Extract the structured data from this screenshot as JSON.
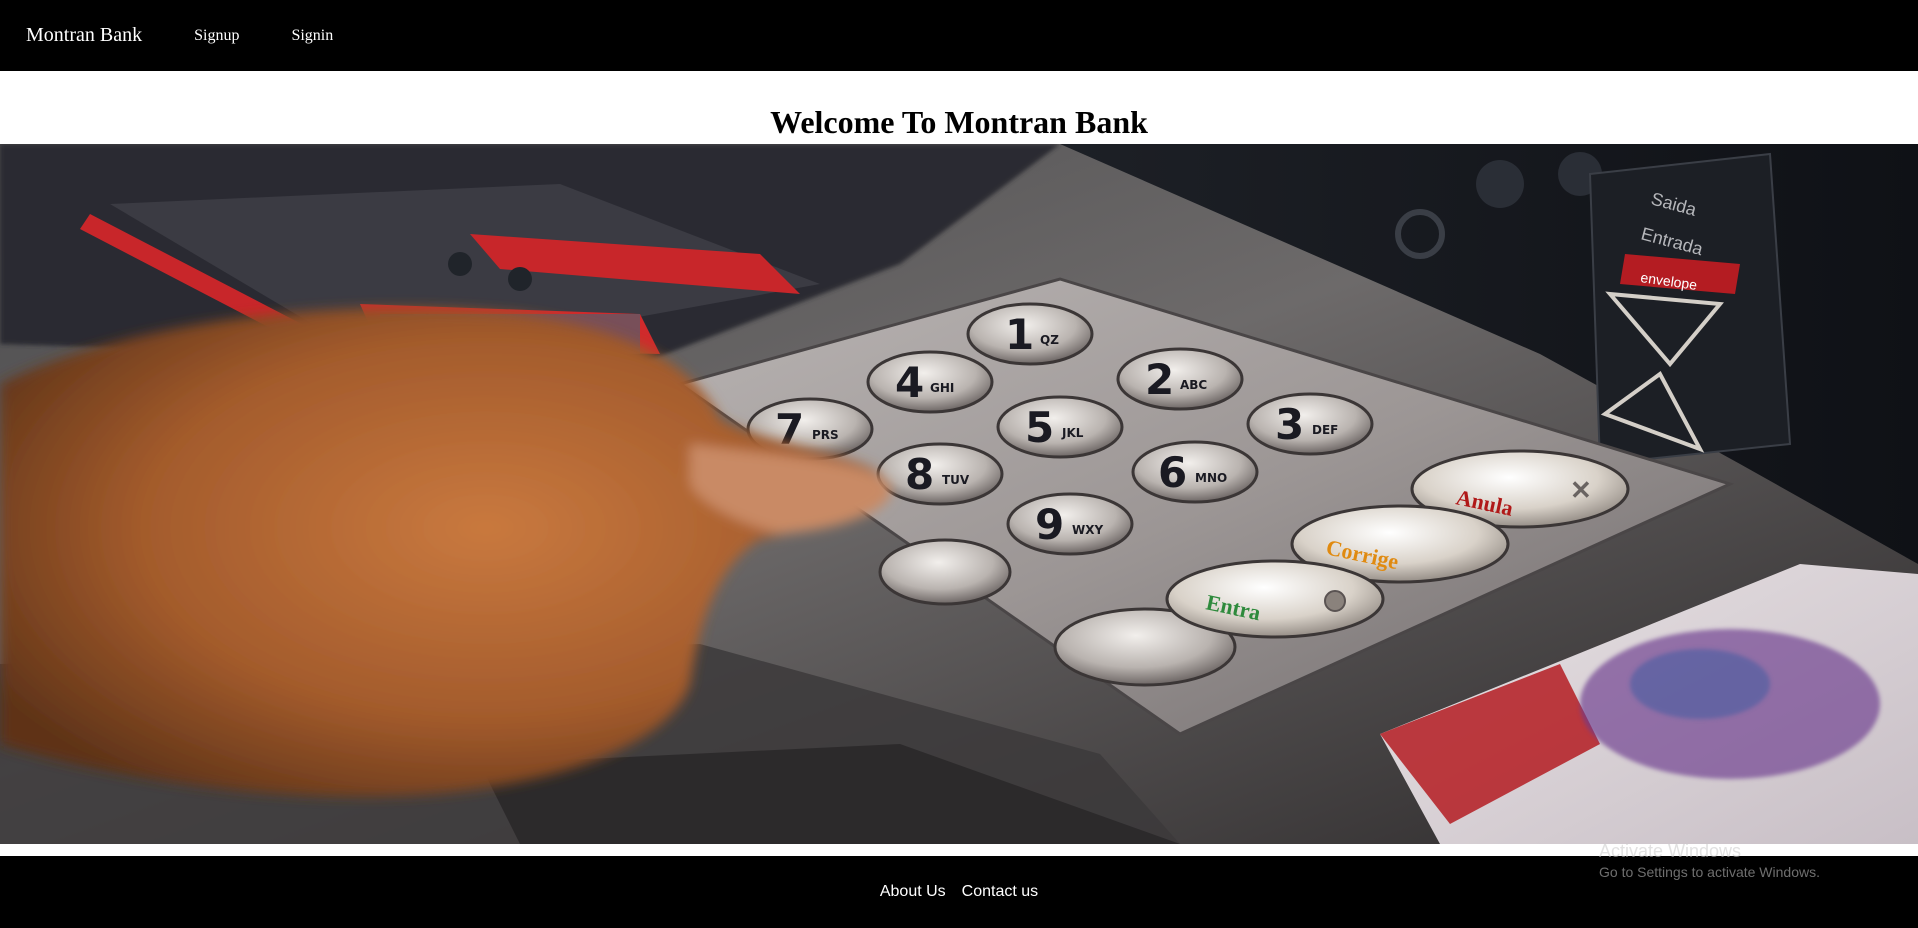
{
  "navbar": {
    "brand": "Montran Bank",
    "links": [
      {
        "label": "Signup"
      },
      {
        "label": "Signin"
      }
    ]
  },
  "main": {
    "title": "Welcome To Montran Bank",
    "hero_image": "atm-keypad-image"
  },
  "keypad": {
    "keys": [
      "1",
      "2",
      "3",
      "4",
      "5",
      "6",
      "7",
      "8",
      "9"
    ],
    "sublabels": [
      "QZ",
      "ABC",
      "DEF",
      "GHI",
      "JKL",
      "MNO",
      "PRS",
      "TUV",
      "WXY"
    ],
    "function_keys": [
      "Anula",
      "Corrige",
      "Entra"
    ],
    "slot_text": [
      "Saida",
      "Entrada",
      "envelope"
    ]
  },
  "footer": {
    "links": [
      {
        "label": "About Us"
      },
      {
        "label": "Contact us"
      }
    ]
  },
  "watermark": {
    "title": "Activate Windows",
    "subtitle": "Go to Settings to activate Windows."
  },
  "colors": {
    "nav_bg": "#000000",
    "footer_bg": "#000000",
    "text_light": "#ffffff",
    "key_black": "#1a1a22",
    "anula_red": "#b01818",
    "corrige_orange": "#e08a10",
    "entra_green": "#2e8a3c"
  }
}
